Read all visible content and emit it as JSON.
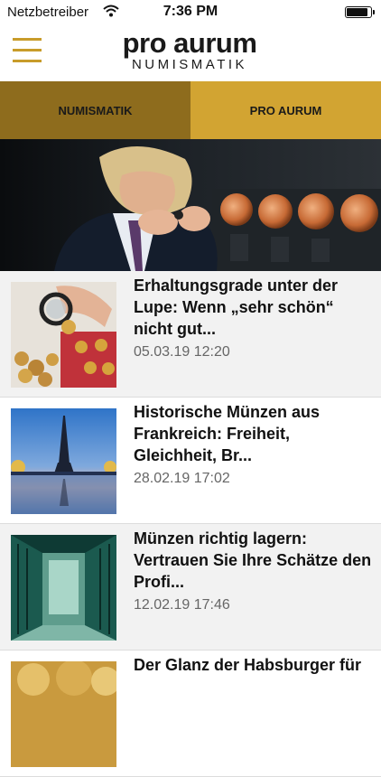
{
  "status_bar": {
    "carrier": "Netzbetreiber",
    "time": "7:36 PM",
    "battery_level": 0.9
  },
  "header": {
    "logo_top": "pro aurum",
    "logo_bottom": "NUMISMATIK",
    "accent_color": "#c89c2a"
  },
  "tabs": [
    {
      "label": "NUMISMATIK",
      "color": "#8e6c1d"
    },
    {
      "label": "PRO AURUM",
      "color": "#d2a432"
    }
  ],
  "articles": [
    {
      "title": "Erhaltungsgrade unter der Lupe: Wenn „sehr schön“ nicht gut...",
      "date": "05.03.19 12:20",
      "image": "coins-magnifier"
    },
    {
      "title": "Historische Münzen aus Frankreich: Freiheit, Gleichheit, Br...",
      "date": "28.02.19 17:02",
      "image": "eiffel-tower"
    },
    {
      "title": "Münzen richtig lagern: Vertrauen Sie Ihre Schätze den Profi...",
      "date": "12.02.19 17:46",
      "image": "vault"
    },
    {
      "title": "Der Glanz der Habsburger für",
      "date": "",
      "image": "gold-coins"
    }
  ]
}
